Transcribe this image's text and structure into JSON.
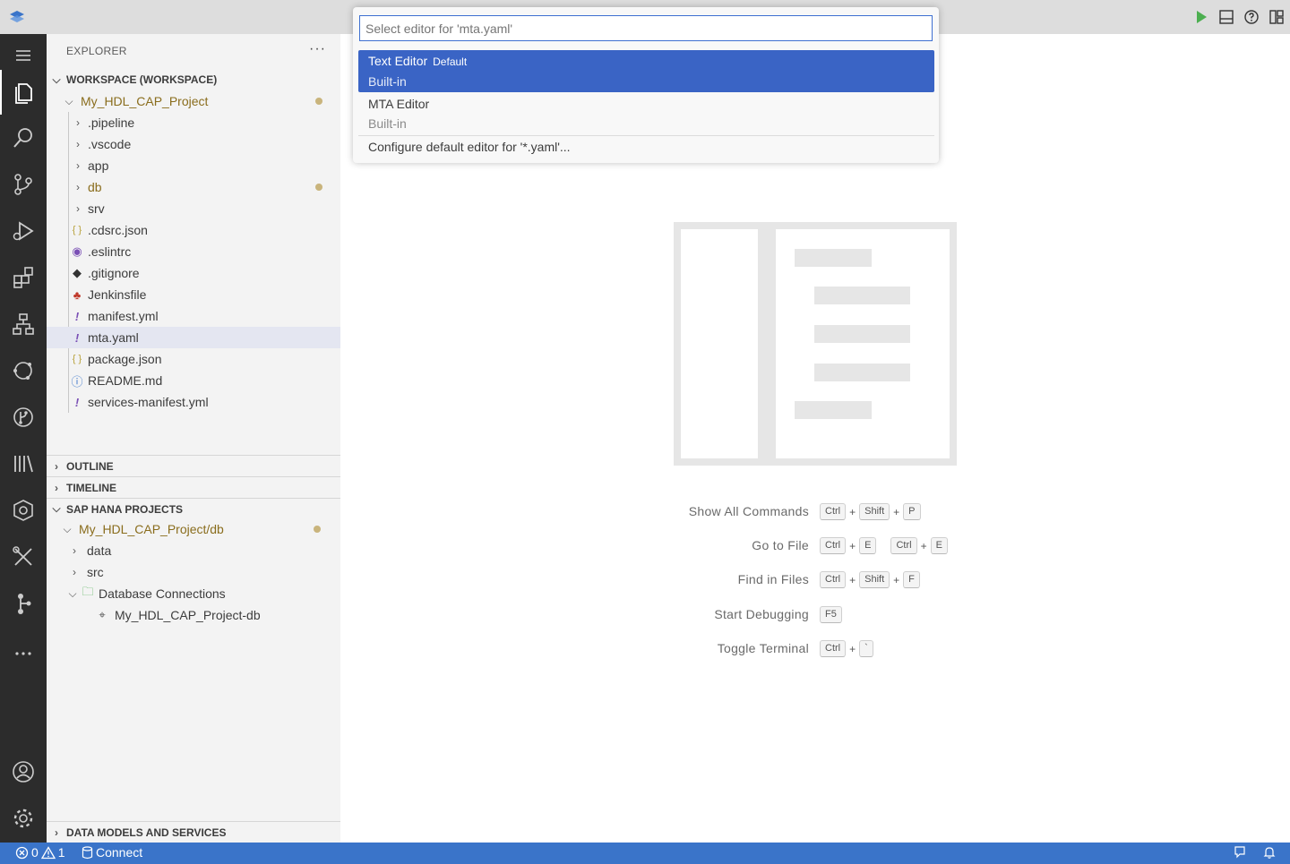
{
  "explorer": {
    "title": "EXPLORER",
    "more": "···",
    "workspace": "WORKSPACE (WORKSPACE)",
    "project": "My_HDL_CAP_Project",
    "items": [
      {
        "label": ".pipeline",
        "type": "folder"
      },
      {
        "label": ".vscode",
        "type": "folder"
      },
      {
        "label": "app",
        "type": "folder"
      },
      {
        "label": "db",
        "type": "folder"
      },
      {
        "label": "srv",
        "type": "folder"
      },
      {
        "label": ".cdsrc.json",
        "type": "file"
      },
      {
        "label": ".eslintrc",
        "type": "file"
      },
      {
        "label": ".gitignore",
        "type": "file"
      },
      {
        "label": "Jenkinsfile",
        "type": "file"
      },
      {
        "label": "manifest.yml",
        "type": "file"
      },
      {
        "label": "mta.yaml",
        "type": "file"
      },
      {
        "label": "package.json",
        "type": "file"
      },
      {
        "label": "README.md",
        "type": "file"
      },
      {
        "label": "services-manifest.yml",
        "type": "file"
      }
    ],
    "outline": "OUTLINE",
    "timeline": "TIMELINE",
    "hana": {
      "title": "SAP HANA PROJECTS",
      "project": "My_HDL_CAP_Project/db",
      "items": [
        "data",
        "src",
        "Database Connections",
        "My_HDL_CAP_Project-db"
      ]
    },
    "data_models": "DATA MODELS AND SERVICES"
  },
  "quickpick": {
    "placeholder": "Select editor for 'mta.yaml'",
    "items": [
      {
        "title": "Text Editor",
        "badge": "Default",
        "desc": "Built-in"
      },
      {
        "title": "MTA Editor",
        "desc": "Built-in"
      }
    ],
    "configure": "Configure default editor for '*.yaml'..."
  },
  "shortcuts": [
    {
      "label": "Show All Commands",
      "keys": [
        [
          "Ctrl",
          "Shift",
          "P"
        ]
      ]
    },
    {
      "label": "Go to File",
      "keys": [
        [
          "Ctrl",
          "E"
        ],
        [
          "Ctrl",
          "E"
        ]
      ]
    },
    {
      "label": "Find in Files",
      "keys": [
        [
          "Ctrl",
          "Shift",
          "F"
        ]
      ]
    },
    {
      "label": "Start Debugging",
      "keys": [
        [
          "F5"
        ]
      ]
    },
    {
      "label": "Toggle Terminal",
      "keys": [
        [
          "Ctrl",
          "`"
        ]
      ]
    }
  ],
  "plus": "+",
  "status": {
    "errors": "0",
    "warnings": "1",
    "connect": "Connect"
  },
  "colors": {
    "accent": "#3a74c9",
    "selection": "#3a64c5",
    "modified_dot": "#c9b47c",
    "run_green": "#4caf50"
  }
}
